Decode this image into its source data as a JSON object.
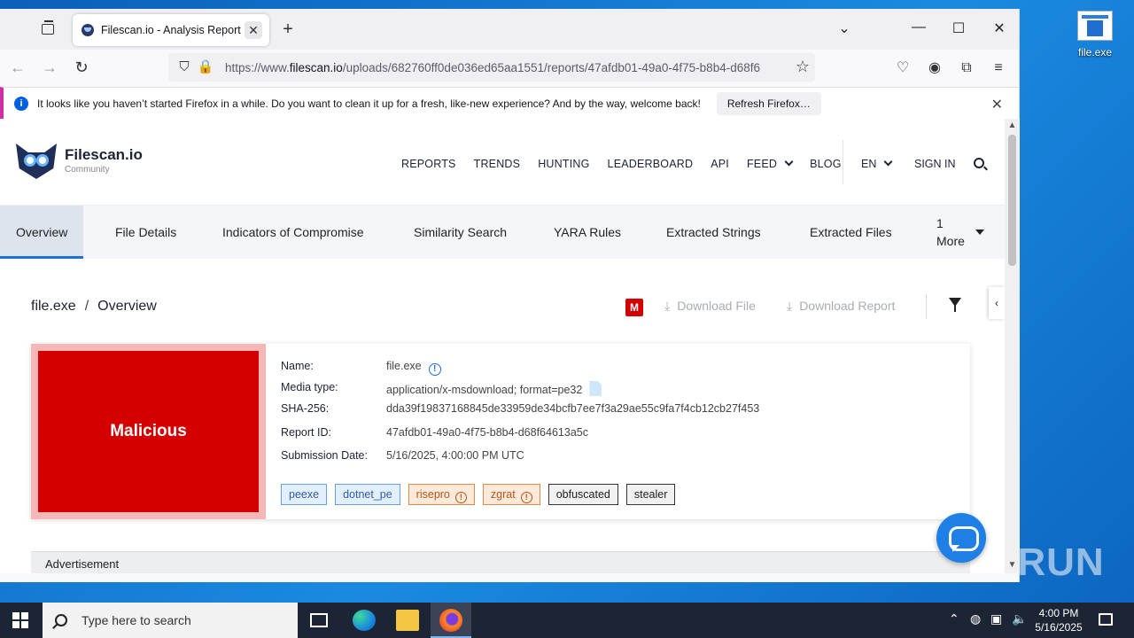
{
  "desktop": {
    "icon_label": "file.exe"
  },
  "browser": {
    "tab_title": "Filescan.io - Analysis Report fo",
    "url_prefix": "https://www.",
    "url_domain": "filescan.io",
    "url_rest": "/uploads/682760ff0de036ed65aa1551/reports/47afdb01-49a0-4f75-b8b4-d68f6",
    "notification": {
      "message": "It looks like you haven’t started Firefox in a while. Do you want to clean it up for a fresh, like-new experience? And by the way, welcome back!",
      "button": "Refresh Firefox…"
    }
  },
  "site": {
    "brand": "Filescan.io",
    "brand_sub": "Community",
    "nav": [
      "REPORTS",
      "TRENDS",
      "HUNTING",
      "LEADERBOARD",
      "API",
      "FEED",
      "BLOG"
    ],
    "lang": "EN",
    "signin": "SIGN IN"
  },
  "subnav": {
    "items": [
      "Overview",
      "File Details",
      "Indicators of Compromise",
      "Similarity Search",
      "YARA Rules",
      "Extracted Strings",
      "Extracted Files"
    ],
    "more_count": "1",
    "more_label": "More"
  },
  "breadcrumb": {
    "file": "file.exe",
    "sep": "/",
    "section": "Overview"
  },
  "actions": {
    "badge": "M",
    "download_file": "Download File",
    "download_report": "Download Report"
  },
  "report": {
    "verdict": "Malicious",
    "fields": {
      "name_label": "Name:",
      "name": "file.exe",
      "media_label": "Media type:",
      "media": "application/x-msdownload; format=pe32",
      "sha_label": "SHA-256:",
      "sha": "dda39f19837168845de33959de34bcfb7ee7f3a29ae55c9fa7f4cb12cb27f453",
      "report_label": "Report ID:",
      "report_id": "47afdb01-49a0-4f75-b8b4-d68f64613a5c",
      "date_label": "Submission Date:",
      "date": "5/16/2025, 4:00:00 PM UTC"
    },
    "tags": [
      {
        "label": "peexe",
        "style": "blue"
      },
      {
        "label": "dotnet_pe",
        "style": "blue"
      },
      {
        "label": "risepro",
        "style": "orange"
      },
      {
        "label": "zgrat",
        "style": "orange"
      },
      {
        "label": "obfuscated",
        "style": "gray"
      },
      {
        "label": "stealer",
        "style": "gray"
      }
    ]
  },
  "advert": "Advertisement",
  "watermark": "ANY RUN",
  "taskbar": {
    "search_placeholder": "Type here to search",
    "time": "4:00 PM",
    "date": "5/16/2025"
  }
}
